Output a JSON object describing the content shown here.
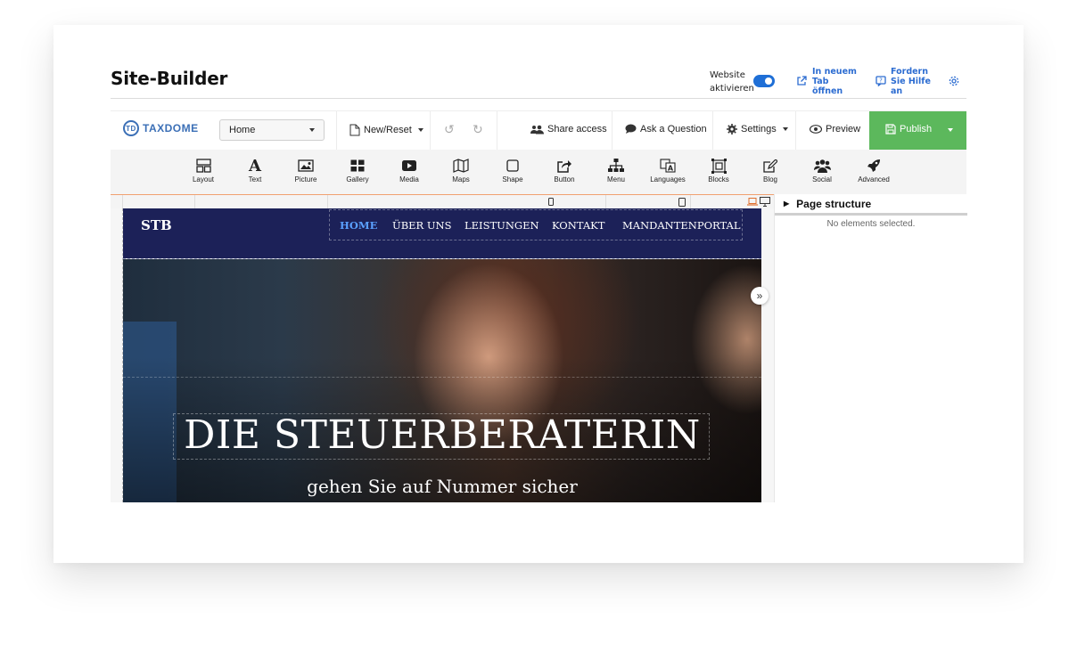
{
  "header": {
    "title": "Site-Builder",
    "website_label_line1": "Website",
    "website_label_line2": "aktivieren",
    "website_enabled": true,
    "open_tab_line1": "In neuem",
    "open_tab_line2": "Tab",
    "open_tab_line3": "öffnen",
    "help_line1": "Fordern",
    "help_line2": "Sie Hilfe",
    "help_line3": "an"
  },
  "toolbar": {
    "logo_text": "TAXDOME",
    "logo_initials": "TD",
    "page_select_value": "Home",
    "new_reset": "New/Reset",
    "share_access": "Share access",
    "ask_question": "Ask a Question",
    "settings": "Settings",
    "preview": "Preview",
    "publish": "Publish"
  },
  "tools": [
    {
      "label": "Layout",
      "icon": "layout-icon"
    },
    {
      "label": "Text",
      "icon": "text-icon"
    },
    {
      "label": "Picture",
      "icon": "picture-icon"
    },
    {
      "label": "Gallery",
      "icon": "gallery-icon"
    },
    {
      "label": "Media",
      "icon": "media-icon"
    },
    {
      "label": "Maps",
      "icon": "maps-icon"
    },
    {
      "label": "Shape",
      "icon": "shape-icon"
    },
    {
      "label": "Button",
      "icon": "button-icon"
    },
    {
      "label": "Menu",
      "icon": "menu-icon"
    },
    {
      "label": "Languages",
      "icon": "languages-icon"
    },
    {
      "label": "Blocks",
      "icon": "blocks-icon"
    },
    {
      "label": "Blog",
      "icon": "blog-icon"
    },
    {
      "label": "Social",
      "icon": "social-icon"
    },
    {
      "label": "Advanced",
      "icon": "advanced-icon"
    }
  ],
  "panel": {
    "title": "Page structure",
    "empty_text": "No elements selected."
  },
  "site": {
    "logo": "STB",
    "nav": [
      "HOME",
      "ÜBER UNS",
      "LEISTUNGEN",
      "KONTAKT",
      "MANDANTENPORTAL"
    ],
    "hero_title": "DIE STEUERBERATERIN",
    "hero_subtitle": "gehen Sie auf Nummer sicher"
  },
  "colors": {
    "publish": "#5cb85c",
    "nav_bg": "#1c2158",
    "accent": "#1f6fd6",
    "active_nav": "#5aa0ff"
  }
}
